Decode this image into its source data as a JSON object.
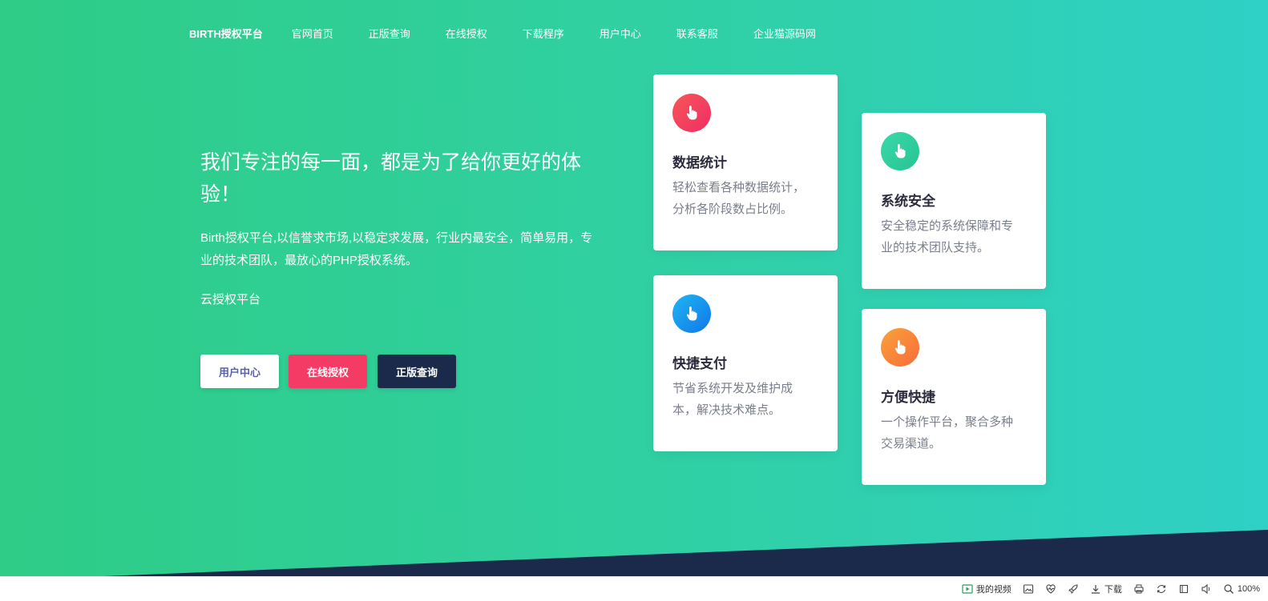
{
  "nav": {
    "brand": "BIRTH授权平台",
    "items": [
      "官网首页",
      "正版查询",
      "在线授权",
      "下载程序",
      "用户中心",
      "联系客服",
      "企业猫源码网"
    ]
  },
  "hero": {
    "headline": "我们专注的每一面，都是为了给你更好的体验！",
    "description": "Birth授权平台,以信誉求市场,以稳定求发展，行业内最安全，简单易用，专业的技术团队，最放心的PHP授权系统。",
    "subtitle": "云授权平台",
    "buttons": {
      "user_center": "用户中心",
      "online_auth": "在线授权",
      "genuine_query": "正版查询"
    }
  },
  "features": [
    {
      "title": "数据统计",
      "text": "轻松查看各种数据统计，分析各阶段数占比例。",
      "icon": "thumbs-up-icon",
      "color": "#f2455f"
    },
    {
      "title": "系统安全",
      "text": "安全稳定的系统保障和专业的技术团队支持。",
      "icon": "thumbs-up-icon",
      "color": "#2ccf9d"
    },
    {
      "title": "快捷支付",
      "text": "节省系统开发及维护成本，解决技术难点。",
      "icon": "thumbs-up-icon",
      "color": "#1a96ee"
    },
    {
      "title": "方便快捷",
      "text": "一个操作平台，聚合多种交易渠道。",
      "icon": "thumbs-up-icon",
      "color": "#f9853b"
    }
  ],
  "colors": {
    "hero_start": "#2ecc86",
    "hero_end": "#2fd0c6",
    "dark_band": "#1b2a4a",
    "accent_red": "#f33b65"
  },
  "statusbar": {
    "my_video": "我的视频",
    "download": "下载",
    "zoom": "100%"
  }
}
